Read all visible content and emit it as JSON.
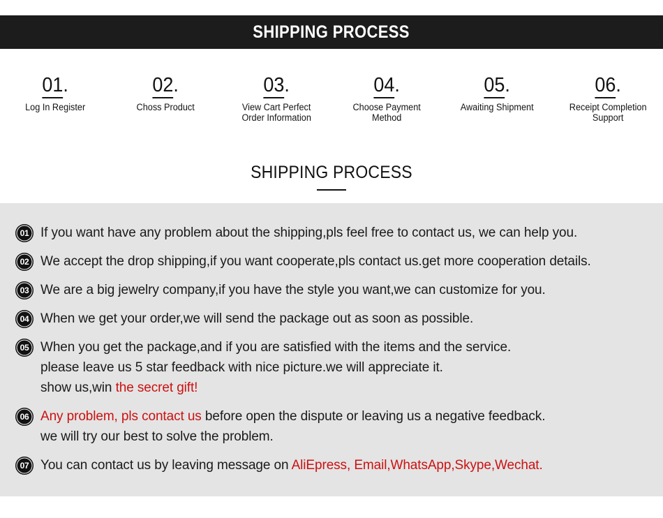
{
  "banner": {
    "title": "SHIPPING PROCESS"
  },
  "steps": [
    {
      "number": "01",
      "dot": ".",
      "label": "Log In Register"
    },
    {
      "number": "02",
      "dot": ".",
      "label": "Choss Product"
    },
    {
      "number": "03",
      "dot": ".",
      "label": "View Cart Perfect\nOrder Information"
    },
    {
      "number": "04",
      "dot": ".",
      "label": "Choose Payment\nMethod"
    },
    {
      "number": "05",
      "dot": ".",
      "label": "Awaiting Shipment"
    },
    {
      "number": "06",
      "dot": ".",
      "label": "Receipt Completion\nSupport"
    }
  ],
  "sub_heading": {
    "title": "SHIPPING PROCESS"
  },
  "faq": [
    {
      "badge": "01",
      "lines": [
        [
          {
            "text": "If you want have any problem about the shipping,pls feel free to contact us, we can help you.",
            "color": "black"
          }
        ]
      ]
    },
    {
      "badge": "02",
      "lines": [
        [
          {
            "text": "We accept the drop shipping,if you want cooperate,pls contact us.get more cooperation details.",
            "color": "black"
          }
        ]
      ]
    },
    {
      "badge": "03",
      "lines": [
        [
          {
            "text": "We are a big jewelry company,if you have the style you want,we can customize for you.",
            "color": "black"
          }
        ]
      ]
    },
    {
      "badge": "04",
      "lines": [
        [
          {
            "text": "When we get your order,we will send the package out as soon as possible.",
            "color": "black"
          }
        ]
      ]
    },
    {
      "badge": "05",
      "lines": [
        [
          {
            "text": "When you get the package,and if you are satisfied with the items and the service.",
            "color": "black"
          }
        ],
        [
          {
            "text": "please leave us 5 star feedback with nice picture.we will appreciate it.",
            "color": "black"
          }
        ],
        [
          {
            "text": "show us,win ",
            "color": "black"
          },
          {
            "text": "the secret gift!",
            "color": "red"
          }
        ]
      ]
    },
    {
      "badge": "06",
      "lines": [
        [
          {
            "text": "Any problem, pls contact us",
            "color": "red"
          },
          {
            "text": " before open the dispute or leaving us a negative feedback.",
            "color": "black"
          }
        ],
        [
          {
            "text": "we will try our best to solve the problem.",
            "color": "black"
          }
        ]
      ]
    },
    {
      "badge": "07",
      "lines": [
        [
          {
            "text": "You can contact us by leaving message on ",
            "color": "black"
          },
          {
            "text": "AliEpress, Email,WhatsApp,Skype,Wechat.",
            "color": "red"
          }
        ]
      ]
    }
  ],
  "colors": {
    "banner_bg": "#1c1c1c",
    "panel_bg": "#e4e4e4",
    "page_bg": "#ffffff",
    "text": "#1a1a1a",
    "accent_red": "#cc1111"
  }
}
